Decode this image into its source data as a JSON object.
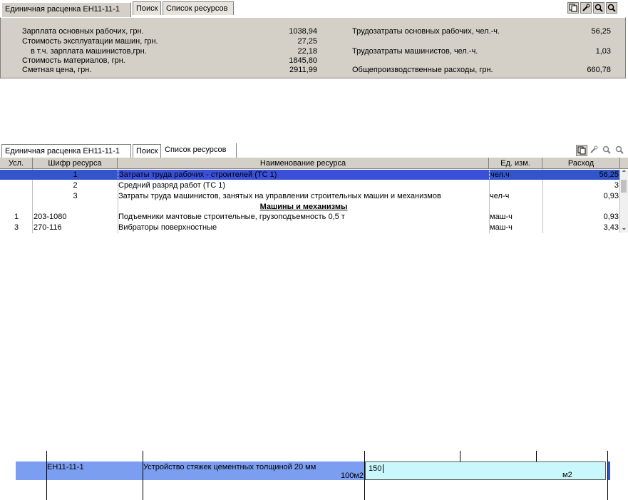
{
  "top_tabs": {
    "items": [
      "Единичная расценка ЕН11-11-1",
      "Поиск",
      "Список ресурсов"
    ],
    "active_index": 0
  },
  "summary": {
    "left": [
      {
        "label": "Зарплата основных рабочих, грн.",
        "value": "1038,94"
      },
      {
        "label": "Стоимость эксплуатации машин, грн.",
        "value": "27,25"
      },
      {
        "label": "в т.ч. зарплата машинистов,грн.",
        "value": "22,18"
      },
      {
        "label": "Стоимость материалов, грн.",
        "value": "1845,80"
      },
      {
        "label": "Сметная цена, грн.",
        "value": "2911,99"
      }
    ],
    "right": [
      {
        "label": "Трудозатраты основных рабочих, чел.-ч.",
        "value": "56,25"
      },
      {
        "label": "Трудозатраты машинистов, чел.-ч.",
        "value": "1,03"
      },
      {
        "label": "Общепроизводственные расходы, грн.",
        "value": "660,78"
      }
    ]
  },
  "mid_tabs": {
    "items": [
      "Единичная расценка ЕН11-11-1",
      "Поиск",
      "Список ресурсов"
    ],
    "active_index": 2
  },
  "resources": {
    "columns": [
      "Усл.",
      "Шифр ресурса",
      "Наименование ресурса",
      "Ед. изм.",
      "Расход"
    ],
    "rows": [
      {
        "usl": "",
        "code": "1",
        "name": "Затраты труда рабочих - строителей (ТС 1)",
        "unit": "чел.ч",
        "qty": "56,25",
        "selected": true
      },
      {
        "usl": "",
        "code": "2",
        "name": "Средний разряд работ (ТС 1)",
        "unit": "",
        "qty": "3"
      },
      {
        "usl": "",
        "code": "3",
        "name": "Затраты труда машинистов, занятых на управлении строительных машин и механизмов",
        "unit": "чел-ч",
        "qty": "0,93"
      },
      {
        "usl": "",
        "code": "",
        "name": "Машины и механизмы",
        "unit": "",
        "qty": "",
        "group": true
      },
      {
        "usl": "1",
        "code": "203-1080",
        "name": "Подъемники мачтовые строительные, грузоподъемность 0,5 т",
        "unit": "маш-ч",
        "qty": "0,93"
      },
      {
        "usl": "3",
        "code": "270-116",
        "name": "Вибраторы поверхностные",
        "unit": "маш-ч",
        "qty": "3,43"
      }
    ]
  },
  "estimate_row": {
    "code": "ЕН11-11-1",
    "name": "Устройство стяжек цементных толщиной 20 мм",
    "unit_note": "100м2",
    "input_value": "150",
    "input_unit": "м2"
  },
  "colors": {
    "selection": "#3355cc",
    "estimate_row": "#7b9ef0",
    "input_bg": "#c8f8fc",
    "panel": "#d4d0c8"
  }
}
